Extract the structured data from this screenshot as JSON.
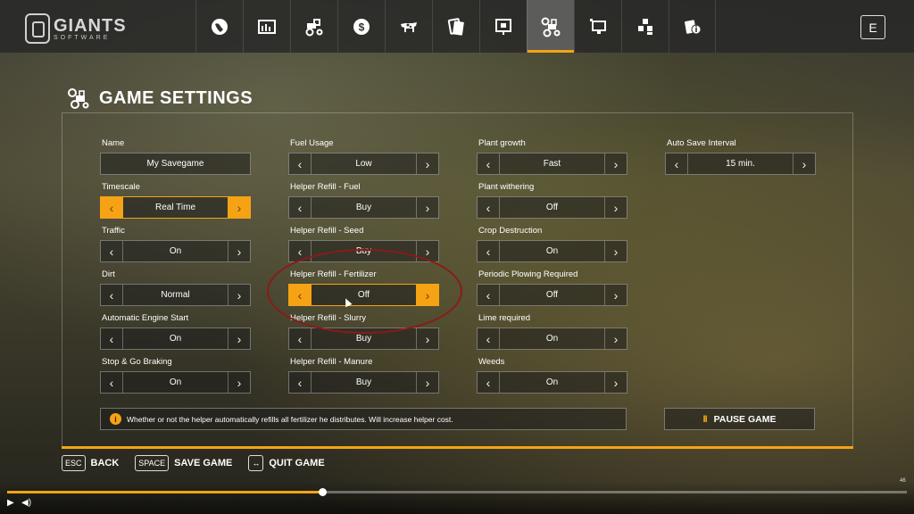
{
  "logo": {
    "brand": "GIANTS",
    "sub": "SOFTWARE"
  },
  "tabs": [
    {
      "name": "map-tab",
      "icon": "globe-icon"
    },
    {
      "name": "prices-tab",
      "icon": "chart-icon"
    },
    {
      "name": "vehicles-tab",
      "icon": "tractor-icon"
    },
    {
      "name": "finances-tab",
      "icon": "dollar-icon"
    },
    {
      "name": "animals-tab",
      "icon": "cow-icon"
    },
    {
      "name": "contracts-tab",
      "icon": "cards-icon"
    },
    {
      "name": "help-tab",
      "icon": "help-screen-icon"
    },
    {
      "name": "game-settings-tab",
      "icon": "settings-tractor-icon",
      "active": true
    },
    {
      "name": "general-settings-tab",
      "icon": "monitor-icon"
    },
    {
      "name": "production-tab",
      "icon": "blocks-icon"
    },
    {
      "name": "info-tab",
      "icon": "info-cards-icon"
    }
  ],
  "exit_key": "E",
  "header": {
    "title": "GAME SETTINGS"
  },
  "columns": [
    [
      {
        "label": "Name",
        "value": "My Savegame",
        "type": "text"
      },
      {
        "label": "Timescale",
        "value": "Real Time",
        "active": true
      },
      {
        "label": "Traffic",
        "value": "On"
      },
      {
        "label": "Dirt",
        "value": "Normal"
      },
      {
        "label": "Automatic Engine Start",
        "value": "On"
      },
      {
        "label": "Stop & Go Braking",
        "value": "On"
      }
    ],
    [
      {
        "label": "Fuel Usage",
        "value": "Low"
      },
      {
        "label": "Helper Refill - Fuel",
        "value": "Buy"
      },
      {
        "label": "Helper Refill - Seed",
        "value": "Buy"
      },
      {
        "label": "Helper Refill - Fertilizer",
        "value": "Off",
        "active": true
      },
      {
        "label": "Helper Refill - Slurry",
        "value": "Buy"
      },
      {
        "label": "Helper Refill - Manure",
        "value": "Buy"
      }
    ],
    [
      {
        "label": "Plant growth",
        "value": "Fast"
      },
      {
        "label": "Plant withering",
        "value": "Off"
      },
      {
        "label": "Crop Destruction",
        "value": "On"
      },
      {
        "label": "Periodic Plowing Required",
        "value": "Off"
      },
      {
        "label": "Lime required",
        "value": "On"
      },
      {
        "label": "Weeds",
        "value": "On"
      }
    ],
    [
      {
        "label": "Auto Save Interval",
        "value": "15 min."
      }
    ]
  ],
  "info": {
    "icon": "i",
    "text": "Whether or not the helper automatically refills all fertilizer he distributes. Will increase helper cost."
  },
  "pause": {
    "icon": "II",
    "label": "PAUSE GAME"
  },
  "actions": [
    {
      "key": "ESC",
      "label": "BACK"
    },
    {
      "key": "SPACE",
      "label": "SAVE GAME"
    },
    {
      "key": "↔",
      "label": "QUIT GAME"
    }
  ],
  "video": {
    "time": "46",
    "progress": 0.35,
    "buffered": 0.16
  },
  "colors": {
    "accent": "#f5a314",
    "annotation": "#8a1a1a"
  }
}
